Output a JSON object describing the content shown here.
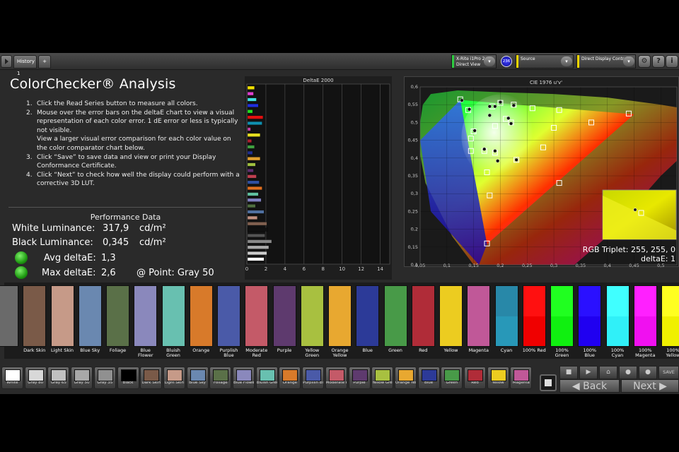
{
  "toolbar": {
    "tab_label": "History 1",
    "add_tab_label": "+",
    "meter": {
      "line1": "X-Rite i1Pro 2",
      "line2": "Direct View",
      "color": "#2ecc40"
    },
    "badge": "236",
    "source": {
      "label": "Source",
      "color": "#f1d600"
    },
    "display": {
      "label": "Direct Display Control",
      "color": "#f1d600"
    }
  },
  "page": {
    "title": "ColorChecker® Analysis",
    "instructions": [
      {
        "num": "1.",
        "text": "Click the Read Series button to measure all colors."
      },
      {
        "num": "2.",
        "text": "Mouse over the error bars on the deltaE chart to view a visual representation of each color error. 1 dE error or less is typically not visible."
      },
      {
        "num": "",
        "text": "View a larger visual error comparison for each color value on the color comparator chart below."
      },
      {
        "num": "3.",
        "text": "Click “Save” to save data and view or print your Display Conformance Certificate."
      },
      {
        "num": "4.",
        "text": "Click “Next” to check how well the display could perform with a corrective 3D LUT."
      }
    ]
  },
  "performance": {
    "title": "Performance Data",
    "white_label": "White Luminance:",
    "white_value": "317,9",
    "white_unit": "cd/m²",
    "black_label": "Black Luminance:",
    "black_value": "0,345",
    "black_unit": "cd/m²",
    "avg_label": "Avg deltaE:",
    "avg_value": "1,3",
    "max_label": "Max deltaE:",
    "max_value": "2,6",
    "point_label": "@ Point: Gray 50"
  },
  "delta_chart": {
    "title": "DeltaE 2000",
    "type": "bar",
    "xlim": [
      0,
      15
    ],
    "ticks": [
      "0",
      "2",
      "4",
      "6",
      "8",
      "10",
      "12",
      "14"
    ],
    "bars": [
      {
        "value": 0.8,
        "color": "#f0e000"
      },
      {
        "value": 0.7,
        "color": "#e040d0"
      },
      {
        "value": 1.0,
        "color": "#40e0e0"
      },
      {
        "value": 1.2,
        "color": "#2030e0"
      },
      {
        "value": 0.6,
        "color": "#20e020"
      },
      {
        "value": 1.7,
        "color": "#e01010"
      },
      {
        "value": 1.6,
        "color": "#1090b0"
      },
      {
        "value": 0.4,
        "color": "#c040a0"
      },
      {
        "value": 1.4,
        "color": "#e8e020"
      },
      {
        "value": 0.5,
        "color": "#b02030"
      },
      {
        "value": 0.8,
        "color": "#40a040"
      },
      {
        "value": 0.6,
        "color": "#203090"
      },
      {
        "value": 1.4,
        "color": "#e0a030"
      },
      {
        "value": 0.9,
        "color": "#a0c040"
      },
      {
        "value": 0.7,
        "color": "#603070"
      },
      {
        "value": 1.0,
        "color": "#c04050"
      },
      {
        "value": 1.3,
        "color": "#3050a0"
      },
      {
        "value": 1.6,
        "color": "#e07020"
      },
      {
        "value": 1.2,
        "color": "#60c0a0"
      },
      {
        "value": 1.5,
        "color": "#8080c0"
      },
      {
        "value": 0.9,
        "color": "#507040"
      },
      {
        "value": 1.8,
        "color": "#5070a0"
      },
      {
        "value": 1.1,
        "color": "#c09080"
      },
      {
        "value": 2.1,
        "color": "#806050"
      },
      {
        "value": 2.2,
        "color": "#111111"
      },
      {
        "value": 1.9,
        "color": "#555555"
      },
      {
        "value": 2.6,
        "color": "#888888"
      },
      {
        "value": 2.3,
        "color": "#aaaaaa"
      },
      {
        "value": 2.1,
        "color": "#cccccc"
      },
      {
        "value": 1.8,
        "color": "#ffffff"
      }
    ]
  },
  "cie": {
    "title": "CIE 1976 u'v'",
    "x_ticks": [
      "0,05",
      "0,1",
      "0,15",
      "0,2",
      "0,25",
      "0,3",
      "0,35",
      "0,4",
      "0,45",
      "0,5"
    ],
    "y_ticks": [
      "0,6",
      "0,55",
      "0,5",
      "0,45",
      "0,4",
      "0,35",
      "0,3",
      "0,25",
      "0,2",
      "0,15",
      "0,1"
    ],
    "xlim": [
      0.05,
      0.53
    ],
    "ylim": [
      0.1,
      0.6
    ],
    "targets": [
      [
        0.125,
        0.565
      ],
      [
        0.14,
        0.535
      ],
      [
        0.15,
        0.475
      ],
      [
        0.145,
        0.455
      ],
      [
        0.145,
        0.42
      ],
      [
        0.17,
        0.42
      ],
      [
        0.19,
        0.415
      ],
      [
        0.19,
        0.49
      ],
      [
        0.2,
        0.555
      ],
      [
        0.225,
        0.55
      ],
      [
        0.185,
        0.545
      ],
      [
        0.26,
        0.54
      ],
      [
        0.31,
        0.535
      ],
      [
        0.21,
        0.51
      ],
      [
        0.22,
        0.5
      ],
      [
        0.3,
        0.485
      ],
      [
        0.37,
        0.5
      ],
      [
        0.44,
        0.525
      ],
      [
        0.28,
        0.43
      ],
      [
        0.23,
        0.395
      ],
      [
        0.175,
        0.36
      ],
      [
        0.18,
        0.295
      ],
      [
        0.31,
        0.33
      ],
      [
        0.175,
        0.16
      ]
    ],
    "measured": [
      [
        0.128,
        0.562
      ],
      [
        0.142,
        0.537
      ],
      [
        0.152,
        0.477
      ],
      [
        0.18,
        0.52
      ],
      [
        0.2,
        0.557
      ],
      [
        0.19,
        0.545
      ],
      [
        0.225,
        0.548
      ],
      [
        0.215,
        0.512
      ],
      [
        0.22,
        0.497
      ],
      [
        0.195,
        0.392
      ],
      [
        0.23,
        0.395
      ],
      [
        0.17,
        0.425
      ],
      [
        0.19,
        0.42
      ],
      [
        0.18,
        0.545
      ]
    ],
    "rgb_triplet": "RGB Triplet: 255, 255, 0",
    "delta_e": "deltaE: 1"
  },
  "comparator": [
    {
      "name": "",
      "top": "#6a6a6a",
      "bot": "#6a6a6a"
    },
    {
      "name": "Dark Skin",
      "top": "#7a5a48",
      "bot": "#7a5a48"
    },
    {
      "name": "Light Skin",
      "top": "#c69a88",
      "bot": "#c69a88"
    },
    {
      "name": "Blue Sky",
      "top": "#6a88b0",
      "bot": "#6a88b0"
    },
    {
      "name": "Foliage",
      "top": "#5a7048",
      "bot": "#5a7048"
    },
    {
      "name": "Blue Flower",
      "top": "#8a88bc",
      "bot": "#8a88bc"
    },
    {
      "name": "Bluish Green",
      "top": "#68c0b0",
      "bot": "#68c0b0"
    },
    {
      "name": "Orange",
      "top": "#d87a2a",
      "bot": "#d87a2a"
    },
    {
      "name": "Purplish Blue",
      "top": "#4a5aa8",
      "bot": "#4a5aa8"
    },
    {
      "name": "Moderate Red",
      "top": "#c45a68",
      "bot": "#c45a68"
    },
    {
      "name": "Purple",
      "top": "#5e3a6e",
      "bot": "#5e3a6e"
    },
    {
      "name": "Yellow Green",
      "top": "#a8c040",
      "bot": "#a8c040"
    },
    {
      "name": "Orange Yellow",
      "top": "#e8a830",
      "bot": "#e8a830"
    },
    {
      "name": "Blue",
      "top": "#2c3a98",
      "bot": "#2c3a98"
    },
    {
      "name": "Green",
      "top": "#489a48",
      "bot": "#489a48"
    },
    {
      "name": "Red",
      "top": "#b02c38",
      "bot": "#b02c38"
    },
    {
      "name": "Yellow",
      "top": "#eccc20",
      "bot": "#eccc20"
    },
    {
      "name": "Magenta",
      "top": "#c05898",
      "bot": "#c05898"
    },
    {
      "name": "Cyan",
      "top": "#2888a8",
      "bot": "#2898b8"
    },
    {
      "name": "100% Red",
      "top": "#ff1010",
      "bot": "#f00000"
    },
    {
      "name": "100% Green",
      "top": "#20ff20",
      "bot": "#10f010"
    },
    {
      "name": "100% Blue",
      "top": "#2a10ff",
      "bot": "#2000f0"
    },
    {
      "name": "100% Cyan",
      "top": "#40ffff",
      "bot": "#30f0f8"
    },
    {
      "name": "100% Magenta",
      "top": "#ff20ff",
      "bot": "#f010f0"
    },
    {
      "name": "100% Yellow",
      "top": "#ffff20",
      "bot": "#f0f000"
    }
  ],
  "swatch_buttons": [
    {
      "label": "White",
      "color": "#ffffff"
    },
    {
      "label": "Gray 80",
      "color": "#d8d8d8"
    },
    {
      "label": "Gray 65",
      "color": "#c0c0c0"
    },
    {
      "label": "Gray 50",
      "color": "#a8a8a8"
    },
    {
      "label": "Gray 35",
      "color": "#909090"
    },
    {
      "label": "Black",
      "color": "#000000"
    },
    {
      "label": "Dark Skin",
      "color": "#7a5a48"
    },
    {
      "label": "Light Skin",
      "color": "#c69a88"
    },
    {
      "label": "Blue Sky",
      "color": "#6a88b0"
    },
    {
      "label": "Foliage",
      "color": "#5a7048"
    },
    {
      "label": "Blue Flower",
      "color": "#8a88bc"
    },
    {
      "label": "Bluish Green",
      "color": "#68c0b0"
    },
    {
      "label": "Orange",
      "color": "#d87a2a"
    },
    {
      "label": "Purplish Blue",
      "color": "#4a5aa8"
    },
    {
      "label": "Moderate Red",
      "color": "#c45a68"
    },
    {
      "label": "Purple",
      "color": "#5e3a6e"
    },
    {
      "label": "Yellow Green",
      "color": "#a8c040"
    },
    {
      "label": "Orange Yellow",
      "color": "#e8a830"
    },
    {
      "label": "Blue",
      "color": "#2c3a98"
    },
    {
      "label": "Green",
      "color": "#489a48"
    },
    {
      "label": "Red",
      "color": "#b02c38"
    },
    {
      "label": "Yellow",
      "color": "#eccc20"
    },
    {
      "label": "Magenta",
      "color": "#c05898"
    }
  ],
  "nav": {
    "save": "SAVE",
    "back": "Back",
    "next": "Next"
  }
}
